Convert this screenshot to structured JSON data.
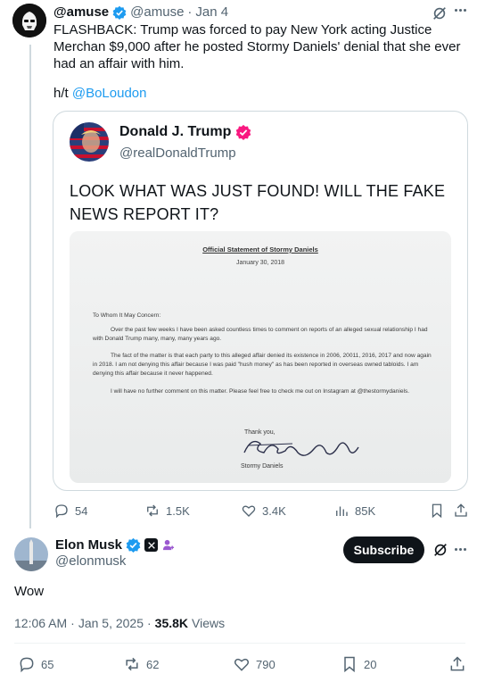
{
  "parent_tweet": {
    "display_name": "@amuse",
    "handle": "@amuse",
    "separator": "·",
    "date": "Jan 4",
    "text": "FLASHBACK: Trump was forced to pay New York acting Justice Merchan $9,000 after he posted Stormy Daniels' denial that she ever had an affair with him.",
    "ht_prefix": "h/t",
    "ht_handle": "@BoLoudon",
    "quote": {
      "display_name": "Donald J. Trump",
      "handle": "@realDonaldTrump",
      "text": "LOOK WHAT WAS JUST FOUND! WILL THE FAKE NEWS REPORT IT?",
      "document": {
        "title": "Official Statement of Stormy Daniels",
        "date": "January 30, 2018",
        "salutation": "To Whom It May Concern:",
        "para1": "Over the past few weeks I have been asked countless times to comment on reports of an alleged sexual relationship I had with Donald Trump many, many, many years ago.",
        "para2": "The fact of the matter is that each party to this alleged affair denied its existence in 2006, 20011, 2016, 2017 and now again in 2018. I am not denying this affair because I was paid \"hush money\" as has been reported in overseas owned tabloids. I am denying this affair because it never happened.",
        "para3": "I will have no further comment on this matter. Please feel free to check me out on Instagram at @thestormydaniels.",
        "closing": "Thank you,",
        "signature": "Stormy Daniels",
        "signer": "Stormy Daniels"
      }
    },
    "stats": {
      "replies": "54",
      "reposts": "1.5K",
      "likes": "3.4K",
      "views": "85K"
    }
  },
  "main_tweet": {
    "display_name": "Elon Musk",
    "handle": "@elonmusk",
    "subscribe_label": "Subscribe",
    "text": "Wow",
    "time": "12:06 AM",
    "dot": "·",
    "date": "Jan 5, 2025",
    "dot2": "·",
    "views_count": "35.8K",
    "views_label": "Views",
    "stats": {
      "replies": "65",
      "reposts": "62",
      "likes": "790",
      "bookmarks": "20"
    }
  },
  "colors": {
    "accent": "#1d9bf0",
    "verified_badge": "#1d9bf0",
    "trump_badge": "#f91880",
    "text_muted": "#536471"
  }
}
